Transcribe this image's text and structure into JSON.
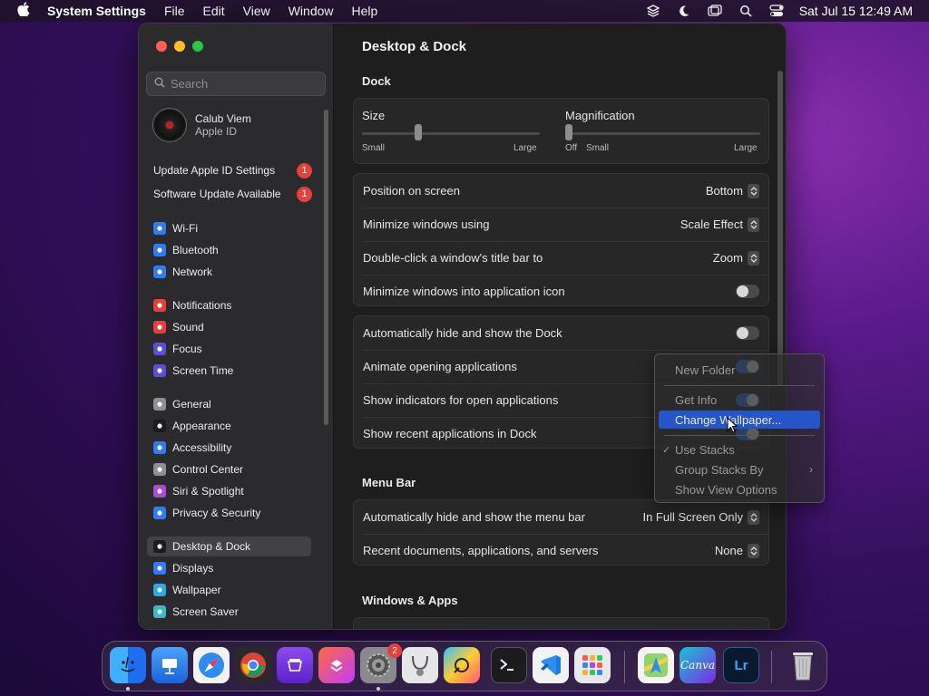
{
  "menubar": {
    "app_name": "System Settings",
    "menus": [
      "File",
      "Edit",
      "View",
      "Window",
      "Help"
    ],
    "clock": "Sat Jul 15  12:49 AM"
  },
  "sidebar": {
    "search_placeholder": "Search",
    "profile": {
      "name": "Calub Viem",
      "subtitle": "Apple ID"
    },
    "notices": [
      {
        "label": "Update Apple ID Settings",
        "badge": "1"
      },
      {
        "label": "Software Update Available",
        "badge": "1"
      }
    ],
    "items": [
      {
        "label": "Wi-Fi",
        "icon": "wifi-icon",
        "color": "#2f7cf6"
      },
      {
        "label": "Bluetooth",
        "icon": "bluetooth-icon",
        "color": "#2f7cf6"
      },
      {
        "label": "Network",
        "icon": "globe-icon",
        "color": "#2f7cf6"
      },
      {
        "label": "Notifications",
        "icon": "bell-icon",
        "color": "#e5403a"
      },
      {
        "label": "Sound",
        "icon": "speaker-icon",
        "color": "#e5403a"
      },
      {
        "label": "Focus",
        "icon": "moon-icon",
        "color": "#5b4fd6"
      },
      {
        "label": "Screen Time",
        "icon": "hourglass-icon",
        "color": "#5b4fd6"
      },
      {
        "label": "General",
        "icon": "gear-icon",
        "color": "#8e8e93"
      },
      {
        "label": "Appearance",
        "icon": "appearance-icon",
        "color": "#1c1c1e"
      },
      {
        "label": "Accessibility",
        "icon": "accessibility-icon",
        "color": "#2f7cf6"
      },
      {
        "label": "Control Center",
        "icon": "control-center-icon",
        "color": "#8e8e93"
      },
      {
        "label": "Siri & Spotlight",
        "icon": "siri-icon",
        "color": "#b04ad6"
      },
      {
        "label": "Privacy & Security",
        "icon": "hand-icon",
        "color": "#2f7cf6"
      },
      {
        "label": "Desktop & Dock",
        "icon": "dock-icon",
        "color": "#1c1c1e",
        "selected": true
      },
      {
        "label": "Displays",
        "icon": "display-icon",
        "color": "#2f7cf6"
      },
      {
        "label": "Wallpaper",
        "icon": "wallpaper-icon",
        "color": "#2fa8e6"
      },
      {
        "label": "Screen Saver",
        "icon": "screensaver-icon",
        "color": "#3ab8c9"
      }
    ]
  },
  "main": {
    "title": "Desktop & Dock",
    "dock_section": "Dock",
    "size": {
      "label": "Size",
      "min_label": "Small",
      "max_label": "Large",
      "value": 0.31
    },
    "magnification": {
      "label": "Magnification",
      "off_label": "Off",
      "min_label": "Small",
      "max_label": "Large",
      "value": 0.0
    },
    "rows_a": [
      {
        "label": "Position on screen",
        "value": "Bottom"
      },
      {
        "label": "Minimize windows using",
        "value": "Scale Effect"
      },
      {
        "label": "Double-click a window's title bar to",
        "value": "Zoom"
      },
      {
        "label": "Minimize windows into application icon",
        "toggle": false
      }
    ],
    "rows_b": [
      {
        "label": "Automatically hide and show the Dock",
        "toggle": false
      },
      {
        "label": "Animate opening applications",
        "toggle": true
      },
      {
        "label": "Show indicators for open applications",
        "toggle": true
      },
      {
        "label": "Show recent applications in Dock",
        "toggle": true
      }
    ],
    "menubar_section": "Menu Bar",
    "rows_c": [
      {
        "label": "Automatically hide and show the menu bar",
        "value": "In Full Screen Only"
      },
      {
        "label": "Recent documents, applications, and servers",
        "value": "None"
      }
    ],
    "windows_section": "Windows & Apps"
  },
  "context_menu": {
    "items": [
      {
        "label": "New Folder"
      },
      {
        "label": "Get Info"
      },
      {
        "label": "Change Wallpaper...",
        "highlighted": true
      },
      {
        "label": "Use Stacks",
        "checked": true
      },
      {
        "label": "Group Stacks By",
        "submenu": true
      },
      {
        "label": "Show View Options"
      }
    ]
  },
  "dock": {
    "settings_badge": "2",
    "canva_label": "Canva",
    "lightroom_label": "Lr"
  }
}
